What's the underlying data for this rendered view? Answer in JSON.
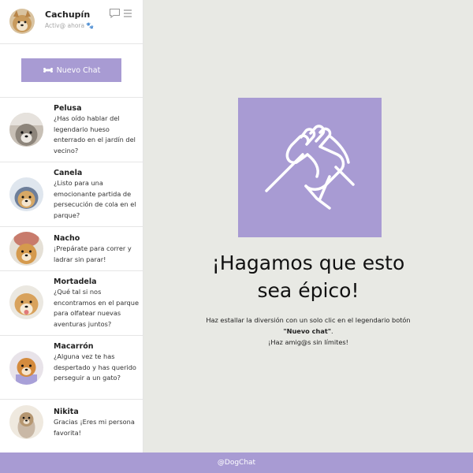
{
  "profile": {
    "name": "Cachupín",
    "status": "Activ@ ahora"
  },
  "sidebar": {
    "new_chat_label": "Nuevo Chat",
    "chats": [
      {
        "name": "Pelusa",
        "message": "¿Has oído hablar del legendario hueso enterrado en el jardín del vecino?"
      },
      {
        "name": "Canela",
        "message": "¿Listo para una emocionante partida de persecución de cola en el parque?"
      },
      {
        "name": "Nacho",
        "message": "¡Prepárate para correr y ladrar sin parar!"
      },
      {
        "name": "Mortadela",
        "message": "¿Qué tal si nos encontramos en el parque para olfatear nuevas aventuras juntos?"
      },
      {
        "name": "Macarrón",
        "message": "¿Alguna vez te has despertado y has querido perseguir a un gato?"
      },
      {
        "name": "Nikita",
        "message": "Gracias ¡Eres mi persona favorita!"
      }
    ]
  },
  "main": {
    "headline_line1": "¡Hagamos que esto",
    "headline_line2": "sea épico!",
    "desc_part1": "Haz estallar la diversión con un solo clic en el legendario botón",
    "desc_bold": "\"Nuevo chat\"",
    "desc_part2": ".",
    "desc_line3": "¡Haz amig@s sin límites!"
  },
  "footer": {
    "text": "@DogChat"
  },
  "icons": [
    "chat-bubble-icon",
    "menu-icon",
    "paw-icon",
    "bone-icon",
    "handshake-icon"
  ],
  "colors": {
    "accent": "#a89bd3",
    "main_bg": "#e8e9e4",
    "online": "#37b24d"
  }
}
